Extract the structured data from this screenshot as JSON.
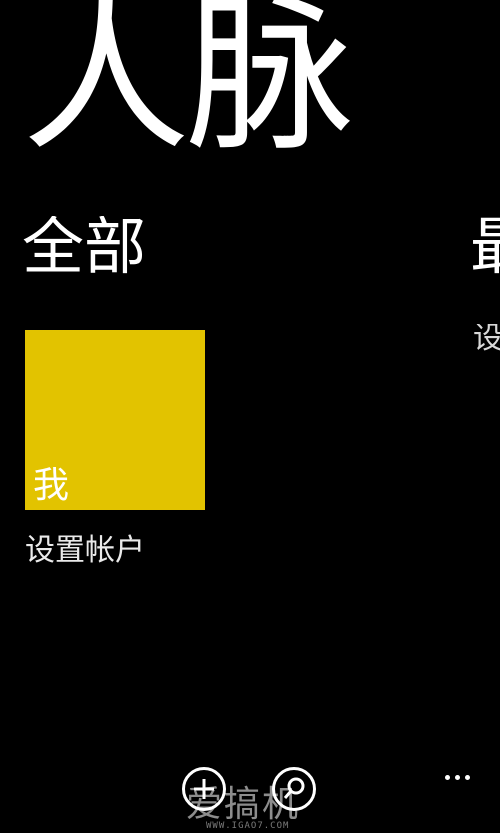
{
  "app": {
    "title": "人脉"
  },
  "pivot": {
    "items": [
      {
        "label": "全部"
      },
      {
        "label": "最"
      }
    ],
    "next_peek_text": "设"
  },
  "me_tile": {
    "label": "我",
    "color": "#e2c300"
  },
  "setup_account": {
    "label": "设置帐户"
  },
  "app_bar": {
    "buttons": [
      {
        "icon": "add-icon"
      },
      {
        "icon": "search-icon"
      }
    ],
    "more_icon": "ellipsis-icon"
  },
  "watermark": {
    "text": "爱搞机",
    "url": "WWW.IGAO7.COM"
  }
}
